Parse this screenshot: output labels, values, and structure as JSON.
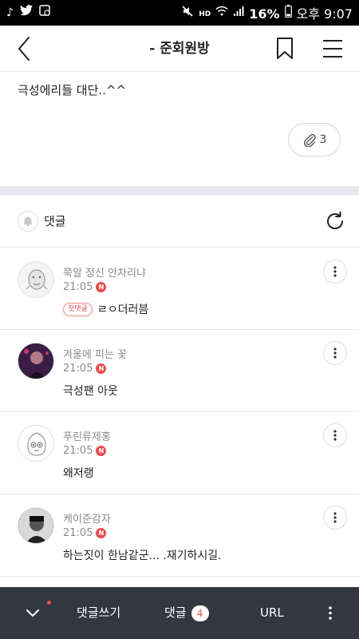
{
  "status_bar": {
    "left_icons": [
      "music-note-icon",
      "twitter-icon",
      "image-icon"
    ],
    "battery": "16%",
    "time": "오후 9:07"
  },
  "header": {
    "title": "-  준회원방"
  },
  "post": {
    "text": "극성에리들 대단..^^",
    "attachment_count": "3"
  },
  "comments_section": {
    "title": "댓글",
    "comments": [
      {
        "nickname": "쭉알 정신 안차리냐",
        "time": "21:05",
        "new": "N",
        "first_badge": "첫댓글",
        "content": "ㄹㅇ더러븜"
      },
      {
        "nickname": "겨울에 피는 꽃",
        "time": "21:05",
        "new": "N",
        "content": "극성팬 아웃"
      },
      {
        "nickname": "푸린류제홍",
        "time": "21:05",
        "new": "N",
        "content": "왜저랭"
      },
      {
        "nickname": "케이준감자",
        "time": "21:05",
        "new": "N",
        "content": "하는짓이 한남같군... .재기하시길."
      }
    ]
  },
  "bottom_bar": {
    "write": "댓글쓰기",
    "comments": "댓글",
    "comment_count": "4",
    "url": "URL"
  },
  "colors": {
    "accent_red": "#e84d4d",
    "bottom_bar": "#333740",
    "divider": "#e8e8ee"
  }
}
